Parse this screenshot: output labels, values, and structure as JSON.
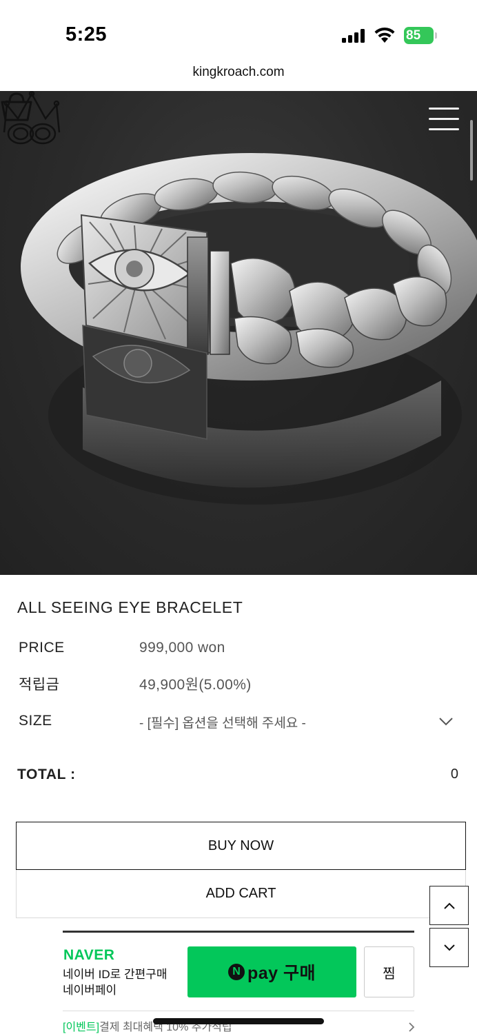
{
  "status_bar": {
    "time": "5:25",
    "battery_level": "85",
    "battery_color": "#34c759",
    "icons": [
      "signal-icon",
      "wifi-icon",
      "battery-icon"
    ]
  },
  "browser": {
    "url": "kingkroach.com"
  },
  "header": {
    "logo_icon": "crown-logo-icon",
    "cart_icon": "shopping-basket-icon",
    "menu_icon": "hamburger-menu-icon"
  },
  "hero": {
    "image_icon": "silver-bracelet-image"
  },
  "product": {
    "title": "ALL SEEING EYE BRACELET",
    "price_label": "PRICE",
    "price_value": "999,000 won",
    "points_label": "적립금",
    "points_value": "49,900원(5.00%)",
    "size_label": "SIZE",
    "size_placeholder": "- [필수] 옵션을 선택해 주세요 -",
    "total_label": "TOTAL :",
    "total_value": "0"
  },
  "actions": {
    "buy_now": "BUY NOW",
    "add_cart": "ADD CART",
    "scroll_up_icon": "chevron-up-icon",
    "scroll_down_icon": "chevron-down-icon"
  },
  "naver_pay": {
    "brand": "NAVER",
    "desc_line1": "네이버 ID로 간편구매",
    "desc_line2": "네이버페이",
    "pay_n": "N",
    "pay_label": "pay 구매",
    "wish_label": "찜",
    "event_tag": "[이벤트]",
    "event_text": "결제 최대혜택 10% 추가적립",
    "brand_color": "#03c75a"
  }
}
